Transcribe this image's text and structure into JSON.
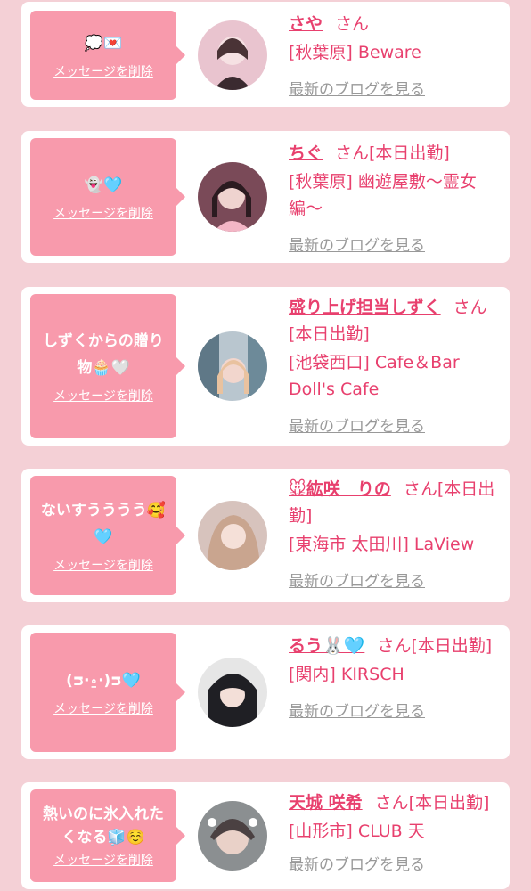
{
  "cards": [
    {
      "bubble_text": "💭💌",
      "delete_label": "メッセージを削除",
      "name": "さや",
      "suffix": "さん",
      "place": "[秋葉原] Beware",
      "blog_link": "最新のブログを見る",
      "avatar_color": "#e9c4cf"
    },
    {
      "bubble_text": "👻🩵",
      "delete_label": "メッセージを削除",
      "name": "ちぐ",
      "suffix": "さん[本日出勤]",
      "place": "[秋葉原] 幽遊屋敷〜霊女編〜",
      "blog_link": "最新のブログを見る",
      "avatar_color": "#7a4a58"
    },
    {
      "bubble_text": "しずくからの贈り物🧁🤍",
      "delete_label": "メッセージを削除",
      "name": "盛り上げ担当しずく",
      "suffix": "さん[本日出勤]",
      "place": "[池袋西口] Cafe＆Bar Doll's Cafe",
      "blog_link": "最新のブログを見る",
      "avatar_color": "#b9c6cf"
    },
    {
      "bubble_text": "ないすうううう🥰🩵",
      "delete_label": "メッセージを削除",
      "name": "🐭紘咲　りの",
      "suffix": "さん[本日出勤]",
      "place": "[東海市 太田川] LaView",
      "blog_link": "最新のブログを見る",
      "avatar_color": "#d7c3bd"
    },
    {
      "bubble_text": "(ᴝ‧⍛‧)ᴝ🩵",
      "delete_label": "メッセージを削除",
      "name": "るう🐰🩵",
      "suffix": "さん[本日出勤]",
      "place": "[関内] KIRSCH",
      "blog_link": "最新のブログを見る",
      "avatar_color": "#3a3a3a"
    },
    {
      "bubble_text": "熱いのに氷入れたくなる🧊☺️",
      "delete_label": "メッセージを削除",
      "name": "天城 咲希",
      "suffix": "さん[本日出勤]",
      "place": "[山形市] CLUB 天",
      "blog_link": "最新のブログを見る",
      "avatar_color": "#8b8f91"
    }
  ]
}
